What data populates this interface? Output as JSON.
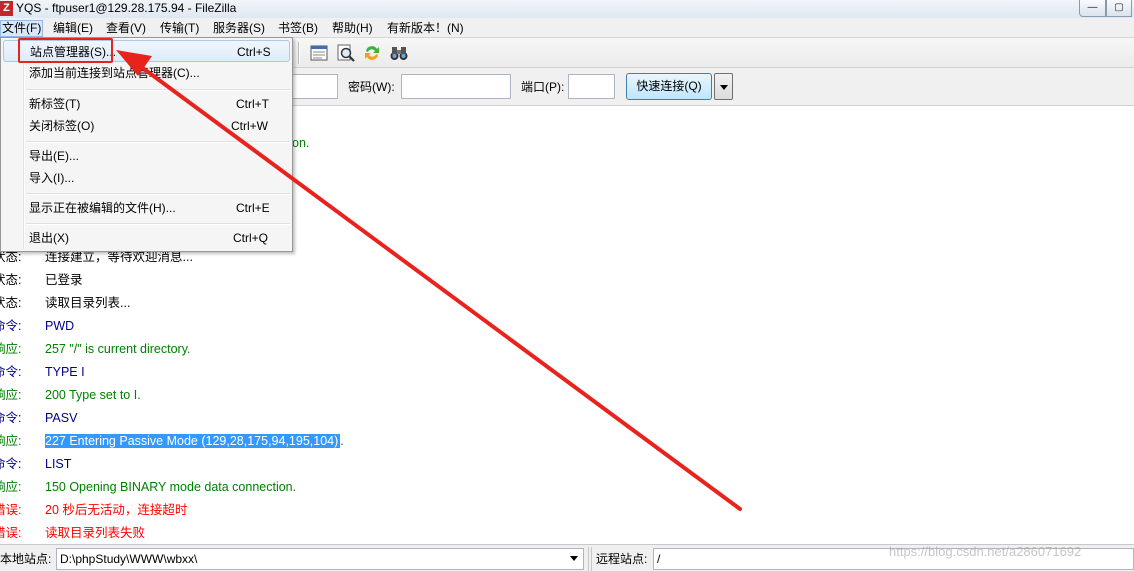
{
  "window": {
    "title": "YQS - ftpuser1@129.28.175.94 - FileZilla",
    "app_icon_glyph": "Z",
    "minimize_glyph": "—",
    "maximize_glyph": "▢"
  },
  "menubar": {
    "items": [
      {
        "label": "文件(F)"
      },
      {
        "label": "编辑(E)"
      },
      {
        "label": "查看(V)"
      },
      {
        "label": "传输(T)"
      },
      {
        "label": "服务器(S)"
      },
      {
        "label": "书签(B)"
      },
      {
        "label": "帮助(H)"
      },
      {
        "label": "有新版本！(N)"
      }
    ]
  },
  "file_menu": {
    "items": [
      {
        "label": "站点管理器(S)...",
        "shortcut": "Ctrl+S"
      },
      {
        "label": "添加当前连接到站点管理器(C)...",
        "shortcut": ""
      },
      {
        "label": "新标签(T)",
        "shortcut": "Ctrl+T"
      },
      {
        "label": "关闭标签(O)",
        "shortcut": "Ctrl+W"
      },
      {
        "label": "导出(E)...",
        "shortcut": ""
      },
      {
        "label": "导入(I)...",
        "shortcut": ""
      },
      {
        "label": "显示正在被编辑的文件(H)...",
        "shortcut": "Ctrl+E"
      },
      {
        "label": "退出(X)",
        "shortcut": "Ctrl+Q"
      }
    ]
  },
  "toolbar": {
    "icons": [
      "message-log-toggle-icon",
      "search-remote-files-icon",
      "compare-directories-icon",
      "binoculars-icon"
    ]
  },
  "quickconnect": {
    "password_label": "密码(W):",
    "port_label": "端口(P):",
    "connect_button": "快速连接(Q)"
  },
  "log": {
    "partial_text": "on.",
    "entries": [
      {
        "type": "状态:",
        "message": "连接建立，等待欢迎消息...",
        "kind": "status"
      },
      {
        "type": "状态:",
        "message": "已登录",
        "kind": "status"
      },
      {
        "type": "状态:",
        "message": "读取目录列表...",
        "kind": "status"
      },
      {
        "type": "命令:",
        "message": "PWD",
        "kind": "command"
      },
      {
        "type": "响应:",
        "message": "257 \"/\" is current directory.",
        "kind": "response"
      },
      {
        "type": "命令:",
        "message": "TYPE I",
        "kind": "command"
      },
      {
        "type": "响应:",
        "message": "200 Type set to I.",
        "kind": "response"
      },
      {
        "type": "命令:",
        "message": "PASV",
        "kind": "command"
      },
      {
        "type": "响应:",
        "message": "227 Entering Passive Mode (129,28,175,94,195,104)",
        "kind": "response",
        "trailing": "."
      },
      {
        "type": "命令:",
        "message": "LIST",
        "kind": "command"
      },
      {
        "type": "响应:",
        "message": "150 Opening BINARY mode data connection.",
        "kind": "response"
      },
      {
        "type": "错误:",
        "message": "20 秒后无活动，连接超时",
        "kind": "error"
      },
      {
        "type": "错误:",
        "message": "读取目录列表失败",
        "kind": "error"
      }
    ]
  },
  "bottombar": {
    "local_label": "本地站点:",
    "local_path": "D:\\phpStudy\\WWW\\wbxx\\",
    "remote_label": "远程站点:",
    "remote_path": "/"
  },
  "watermark": "https://blog.csdn.net/a286071692",
  "colors": {
    "status": "#000000",
    "command": "#00008b",
    "response": "#008000",
    "error": "#ff0000",
    "selection": "#3399ff",
    "annotation": "#e8231e"
  }
}
